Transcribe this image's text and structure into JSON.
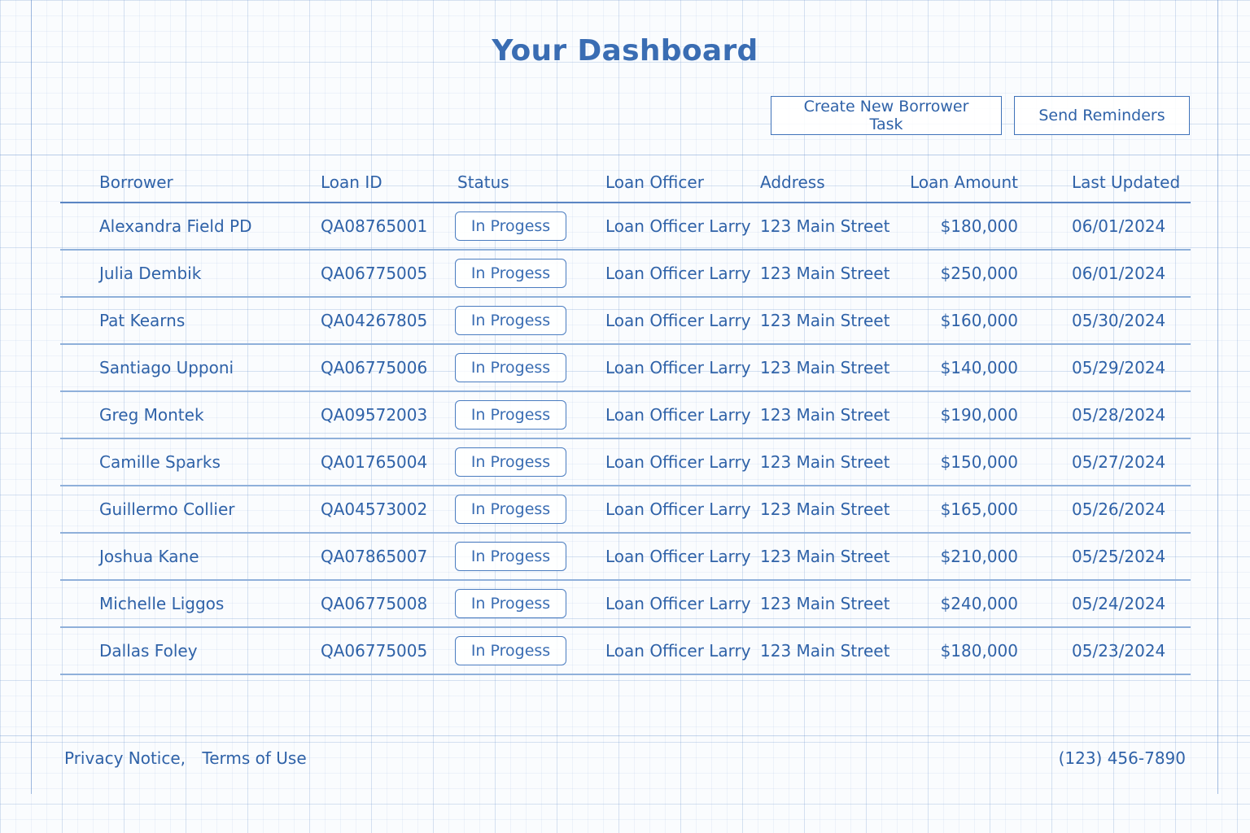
{
  "header": {
    "title": "Your Dashboard"
  },
  "actions": {
    "create_label": "Create New Borrower Task",
    "remind_label": "Send Reminders"
  },
  "table": {
    "columns": [
      "Borrower",
      "Loan ID",
      "Status",
      "Loan Officer",
      "Address",
      "Loan Amount",
      "Last Updated"
    ],
    "rows": [
      {
        "borrower": "Alexandra Field PD",
        "loan_id": "QA08765001",
        "status": "In Progess",
        "officer": "Loan Officer Larry",
        "address": "123 Main Street",
        "amount": "$180,000",
        "updated": "06/01/2024"
      },
      {
        "borrower": "Julia Dembik",
        "loan_id": "QA06775005",
        "status": "In Progess",
        "officer": "Loan Officer Larry",
        "address": "123 Main Street",
        "amount": "$250,000",
        "updated": "06/01/2024"
      },
      {
        "borrower": "Pat Kearns",
        "loan_id": "QA04267805",
        "status": "In Progess",
        "officer": "Loan Officer Larry",
        "address": "123 Main Street",
        "amount": "$160,000",
        "updated": "05/30/2024"
      },
      {
        "borrower": "Santiago Upponi",
        "loan_id": "QA06775006",
        "status": "In Progess",
        "officer": "Loan Officer Larry",
        "address": "123 Main Street",
        "amount": "$140,000",
        "updated": "05/29/2024"
      },
      {
        "borrower": "Greg Montek",
        "loan_id": "QA09572003",
        "status": "In Progess",
        "officer": "Loan Officer Larry",
        "address": "123 Main Street",
        "amount": "$190,000",
        "updated": "05/28/2024"
      },
      {
        "borrower": "Camille Sparks",
        "loan_id": "QA01765004",
        "status": "In Progess",
        "officer": "Loan Officer Larry",
        "address": "123 Main Street",
        "amount": "$150,000",
        "updated": "05/27/2024"
      },
      {
        "borrower": "Guillermo Collier",
        "loan_id": "QA04573002",
        "status": "In Progess",
        "officer": "Loan Officer Larry",
        "address": "123 Main Street",
        "amount": "$165,000",
        "updated": "05/26/2024"
      },
      {
        "borrower": "Joshua Kane",
        "loan_id": "QA07865007",
        "status": "In Progess",
        "officer": "Loan Officer Larry",
        "address": "123 Main Street",
        "amount": "$210,000",
        "updated": "05/25/2024"
      },
      {
        "borrower": "Michelle Liggos",
        "loan_id": "QA06775008",
        "status": "In Progess",
        "officer": "Loan Officer Larry",
        "address": "123 Main Street",
        "amount": "$240,000",
        "updated": "05/24/2024"
      },
      {
        "borrower": "Dallas Foley",
        "loan_id": "QA06775005",
        "status": "In Progess",
        "officer": "Loan Officer Larry",
        "address": "123 Main Street",
        "amount": "$180,000",
        "updated": "05/23/2024"
      }
    ]
  },
  "footer": {
    "privacy": "Privacy Notice,",
    "terms": "Terms of Use",
    "phone": "(123) 456-7890"
  },
  "colors": {
    "accent": "#2f62a8",
    "title": "#3a6db3",
    "grid": "#78a0d2"
  }
}
